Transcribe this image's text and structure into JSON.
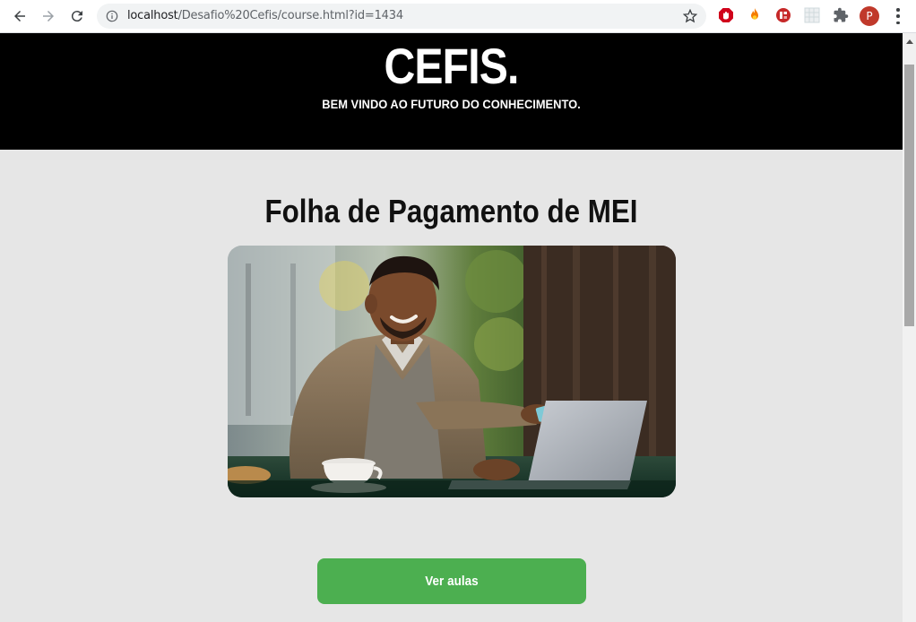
{
  "browser": {
    "url_host": "localhost",
    "url_path": "/Desafio%20Cefis/course.html?id=1434",
    "profile_initial": "P",
    "icons": [
      "back-icon",
      "forward-icon",
      "reload-icon",
      "info-icon",
      "star-icon",
      "adblock-extension-icon",
      "fire-extension-icon",
      "stop-extension-icon",
      "grid-extension-icon",
      "puzzle-extensions-icon",
      "more-menu-icon"
    ]
  },
  "header": {
    "brand": "CEFIS.",
    "tagline": "BEM VINDO AO FUTURO DO CONHECIMENTO."
  },
  "course": {
    "title": "Folha de Pagamento de MEI",
    "image_alt": "course-thumbnail",
    "cta_label": "Ver aulas"
  },
  "colors": {
    "header_bg": "#000000",
    "page_bg": "#e6e6e6",
    "cta_bg": "#4caf50"
  }
}
